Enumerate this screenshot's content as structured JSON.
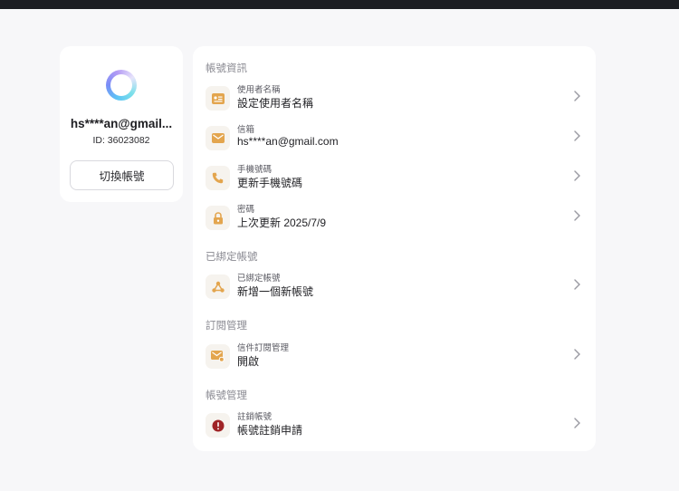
{
  "profile": {
    "username": "hs****an@gmail...",
    "user_id": "ID: 36023082",
    "switch_account": "切換帳號"
  },
  "sections": {
    "account_info": {
      "title": "帳號資訊",
      "username_row": {
        "label": "使用者名稱",
        "value": "設定使用者名稱",
        "icon": "id-card-icon"
      },
      "email_row": {
        "label": "信箱",
        "value": "hs****an@gmail.com",
        "icon": "mail-icon"
      },
      "phone_row": {
        "label": "手機號碼",
        "value": "更新手機號碼",
        "icon": "phone-icon"
      },
      "password_row": {
        "label": "密碼",
        "value": "上次更新 2025/7/9",
        "icon": "lock-icon"
      }
    },
    "linked_accounts": {
      "title": "已綁定帳號",
      "linked_row": {
        "label": "已綁定帳號",
        "value": "新增一個新帳號",
        "icon": "link-nodes-icon"
      }
    },
    "subscriptions": {
      "title": "訂閱管理",
      "email_sub_row": {
        "label": "信件訂閱管理",
        "value": "開啟",
        "icon": "mail-settings-icon"
      }
    },
    "account_management": {
      "title": "帳號管理",
      "delete_row": {
        "label": "註銷帳號",
        "value": "帳號註銷申請",
        "icon": "alert-icon"
      }
    }
  },
  "colors": {
    "accent_icon": "#e3a54e",
    "danger_icon": "#9f2326",
    "topbar": "#1b1d22"
  }
}
